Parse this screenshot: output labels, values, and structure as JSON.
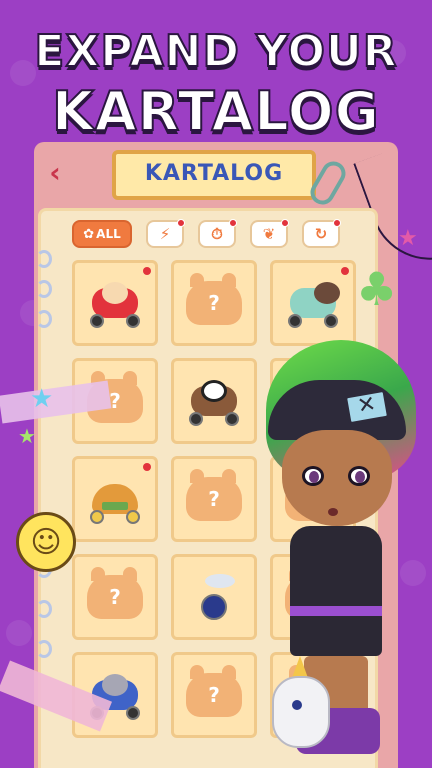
{
  "promo": {
    "line1": "EXPAND YOUR",
    "line2": "KARTALOG"
  },
  "header": {
    "back_icon": "chevron-left-icon",
    "title": "KARTALOG"
  },
  "filters": [
    {
      "label": "ALL",
      "icon": "paw-icon",
      "selected": true,
      "new": false
    },
    {
      "label": "",
      "icon": "lightning-icon",
      "selected": false,
      "new": true
    },
    {
      "label": "",
      "icon": "alarm-clock-icon",
      "selected": false,
      "new": true
    },
    {
      "label": "",
      "icon": "leaf-icon",
      "selected": false,
      "new": true
    },
    {
      "label": "",
      "icon": "refresh-icon",
      "selected": false,
      "new": true
    }
  ],
  "karts": [
    {
      "name": "red-rocket-kart",
      "locked": false,
      "new": true
    },
    {
      "name": "unknown",
      "locked": true,
      "new": false
    },
    {
      "name": "squirrel-kart",
      "locked": false,
      "new": true
    },
    {
      "name": "unknown",
      "locked": true,
      "new": false
    },
    {
      "name": "panda-kart",
      "locked": false,
      "new": false
    },
    {
      "name": "unknown",
      "locked": true,
      "new": false
    },
    {
      "name": "burger-kart",
      "locked": false,
      "new": true
    },
    {
      "name": "unknown",
      "locked": true,
      "new": false
    },
    {
      "name": "unknown",
      "locked": true,
      "new": false
    },
    {
      "name": "unknown",
      "locked": true,
      "new": false
    },
    {
      "name": "unicycle-kart",
      "locked": false,
      "new": false
    },
    {
      "name": "unknown",
      "locked": true,
      "new": false
    },
    {
      "name": "cat-kart",
      "locked": false,
      "new": false
    },
    {
      "name": "unknown",
      "locked": true,
      "new": false
    },
    {
      "name": "unknown",
      "locked": true,
      "new": false
    }
  ],
  "locked_marker": "?",
  "colors": {
    "background": "#9c3fc4",
    "accent": "#f07a3f",
    "title_text": "#3a57b7",
    "new_dot": "#e2333c"
  }
}
